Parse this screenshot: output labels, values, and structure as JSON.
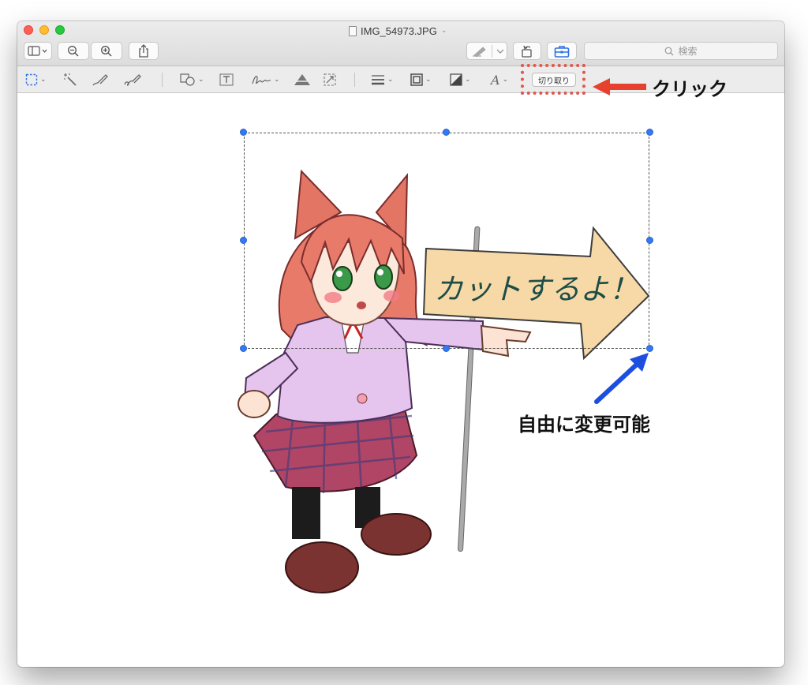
{
  "window": {
    "title": "IMG_54973.JPG",
    "title_chevron": "⌄"
  },
  "toolbar": {
    "sidebar_icon": "sidebar-icon",
    "zoom_out_icon": "zoom-out-icon",
    "zoom_in_icon": "zoom-in-icon",
    "share_icon": "share-icon",
    "markup_pen_icon": "markup-pen-icon",
    "rotate_icon": "rotate-icon",
    "toolbox_icon": "toolbox-icon",
    "search_placeholder": "検索"
  },
  "markup": {
    "crop_label": "切り取り",
    "font_glyph": "A"
  },
  "image": {
    "sign_text": "カットするよ！"
  },
  "annotations": {
    "click_label": "クリック",
    "free_label": "自由に変更可能"
  },
  "colors": {
    "selection_handle": "#3478f6",
    "red_arrow": "#e8402f",
    "blue_arrow": "#1c4fe0",
    "highlight_box": "#e0574b"
  }
}
